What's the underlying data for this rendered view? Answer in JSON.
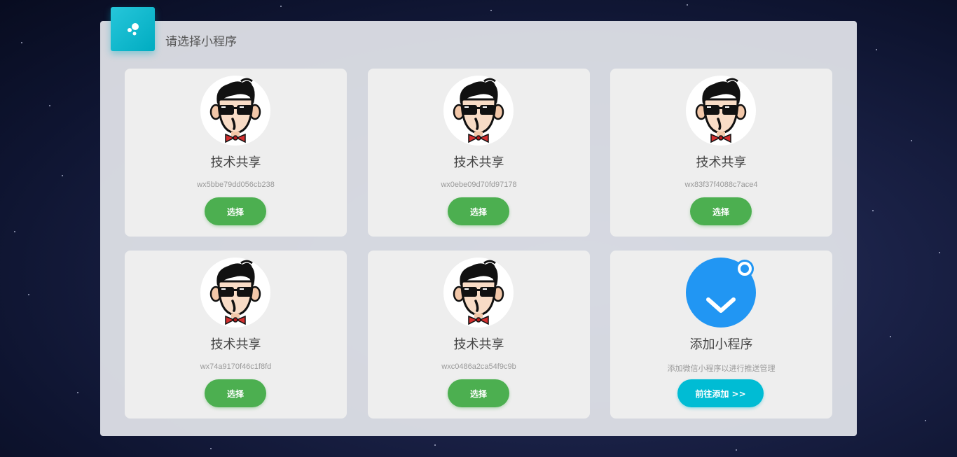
{
  "header": {
    "title": "请选择小程序"
  },
  "apps": [
    {
      "name": "技术共享",
      "appid": "wx5bbe79dd056cb238",
      "button": "选择"
    },
    {
      "name": "技术共享",
      "appid": "wx0ebe09d70fd97178",
      "button": "选择"
    },
    {
      "name": "技术共享",
      "appid": "wx83f37f4088c7ace4",
      "button": "选择"
    },
    {
      "name": "技术共享",
      "appid": "wx74a9170f46c1f8fd",
      "button": "选择"
    },
    {
      "name": "技术共享",
      "appid": "wxc0486a2ca54f9c9b",
      "button": "选择"
    }
  ],
  "add_card": {
    "title": "添加小程序",
    "description": "添加微信小程序以进行推送管理",
    "button": "前往添加 >>",
    "icon": "miniprogram-icon"
  },
  "colors": {
    "select_button": "#4caf50",
    "add_button": "#00bcd4",
    "add_icon": "#2196f3",
    "badge": "#00bcd4"
  }
}
